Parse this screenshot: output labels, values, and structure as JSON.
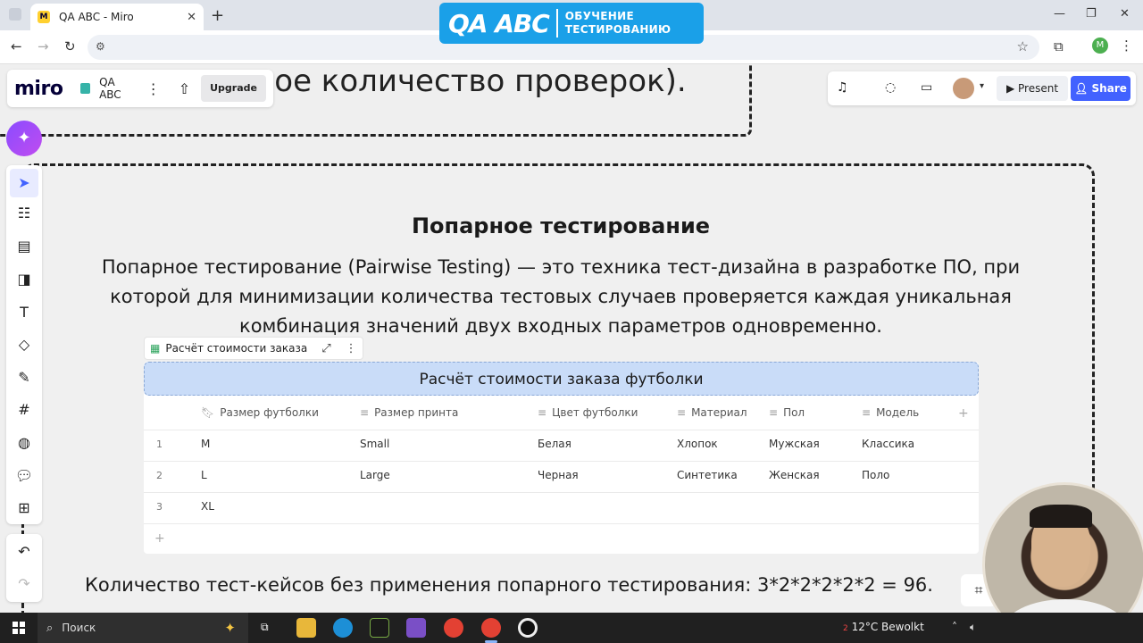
{
  "browser": {
    "tab_title": "QA ABC - Miro",
    "tab_favicon": "miro-favicon",
    "profile_initial": "M"
  },
  "overlay_logo": {
    "text": "QA ABC",
    "subtitle_line1": "ОБУЧЕНИЕ",
    "subtitle_line2": "ТЕСТИРОВАНИЮ",
    "color": "#1aa0e8"
  },
  "miro": {
    "logo": "miro",
    "board_name": "QA ABC",
    "upgrade_label": "Upgrade",
    "present_label": "Present",
    "share_label": "Share",
    "share_color": "#4262ff"
  },
  "board": {
    "previous_text": "ьное количество проверок).",
    "frame_title": "Попарное тестирование",
    "frame_description": "Попарное тестирование (Pairwise Testing) — это техника тест-дизайна в разработке ПО, при которой для минимизации количества тестовых случаев проверяется каждая уникальная комбинация значений двух входных параметров одновременно.",
    "table_label": "Расчёт стоимости заказа",
    "table": {
      "title": "Расчёт стоимости заказа футболки",
      "columns": [
        "Размер футболки",
        "Размер принта",
        "Цвет футболки",
        "Материал",
        "Пол",
        "Модель"
      ],
      "rows": [
        {
          "n": "1",
          "cells": [
            "M",
            "Small",
            "Белая",
            "Хлопок",
            "Мужская",
            "Классика"
          ]
        },
        {
          "n": "2",
          "cells": [
            "L",
            "Large",
            "Черная",
            "Синтетика",
            "Женская",
            "Поло"
          ]
        },
        {
          "n": "3",
          "cells": [
            "XL",
            "",
            "",
            "",
            "",
            ""
          ]
        }
      ]
    },
    "bottom_text": "Количество тест-кейсов без применения попарного тестирования: 3*2*2*2*2*2 = 96."
  },
  "taskbar": {
    "search_placeholder": "Поиск",
    "weather_badge": "2",
    "weather_text": "12°C  Bewolkt"
  }
}
